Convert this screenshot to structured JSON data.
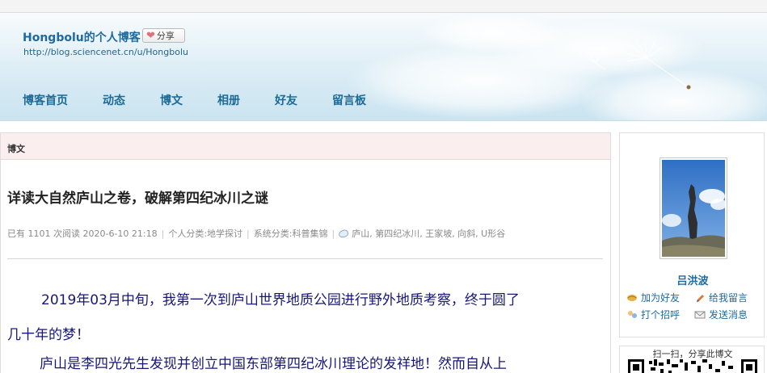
{
  "header": {
    "blog_title": "Hongbolu的个人博客",
    "share_label": "分享",
    "blog_url": "http://blog.sciencenet.cn/u/Hongbolu"
  },
  "nav": {
    "items": [
      "博客首页",
      "动态",
      "博文",
      "相册",
      "好友",
      "留言板"
    ]
  },
  "section": {
    "label": "博文"
  },
  "post": {
    "title": "详读大自然庐山之卷，破解第四纪冰川之谜",
    "meta": {
      "reads": "已有 1101 次阅读 2020-6-10 21:18",
      "personal_category": "个人分类:地学探讨",
      "system_category": "系统分类:科普集锦",
      "tags": "庐山, 第四纪冰川, 王家坡, 向斜, U形谷"
    },
    "paragraphs": [
      "2019年03月中旬，我第一次到庐山世界地质公园进行野外地质考察，终于圆了",
      "几十年的梦！",
      "庐山是李四光先生发现并创立中国东部第四纪冰川理论的发祥地！然而自从上"
    ]
  },
  "sidebar": {
    "user_name": "吕洪波",
    "links": {
      "add_friend": "加为好友",
      "leave_message": "给我留言",
      "greet": "打个招呼",
      "send_message": "发送消息"
    },
    "qr_label": "扫一扫，分享此博文"
  },
  "colors": {
    "link_blue": "#1d6a9f",
    "body_text": "#17177a",
    "section_bar": "#fbeeee"
  }
}
